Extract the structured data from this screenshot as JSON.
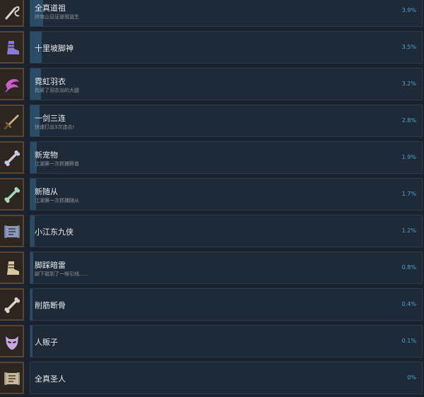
{
  "achievements": [
    {
      "title": "全真道祖",
      "description": "终南山见证道祖诞生",
      "percent": "3.9%",
      "fill_fraction": 0.039,
      "icon": "whip-icon",
      "icon_color": "#d8d2c8"
    },
    {
      "title": "十里坡脚神",
      "description": "",
      "percent": "3.5%",
      "fill_fraction": 0.035,
      "icon": "boot-icon",
      "icon_color": "#8a7ad8"
    },
    {
      "title": "霓虹羽衣",
      "description": "抱紧了羽衣派的大腿",
      "percent": "3.2%",
      "fill_fraction": 0.032,
      "icon": "feather-icon",
      "icon_color": "#c860c8"
    },
    {
      "title": "一剑三连",
      "description": "快速打出3次连击!",
      "percent": "2.8%",
      "fill_fraction": 0.028,
      "icon": "sword-icon",
      "icon_color": "#c8b078"
    },
    {
      "title": "新宠物",
      "description": "江湖第一次抓捕野兽",
      "percent": "1.9%",
      "fill_fraction": 0.019,
      "icon": "bone-icon",
      "icon_color": "#c8c8e0"
    },
    {
      "title": "新随从",
      "description": "江湖第一次抓捕随从",
      "percent": "1.7%",
      "fill_fraction": 0.017,
      "icon": "bone-icon",
      "icon_color": "#a8d8b8"
    },
    {
      "title": "小江东九侠",
      "description": "",
      "percent": "1.2%",
      "fill_fraction": 0.012,
      "icon": "scroll-icon",
      "icon_color": "#8898c0"
    },
    {
      "title": "脚踩暗雷",
      "description": "脚下碰到了一根引线......",
      "percent": "0.8%",
      "fill_fraction": 0.008,
      "icon": "boot-icon",
      "icon_color": "#d8c8a0"
    },
    {
      "title": "削筋断骨",
      "description": "",
      "percent": "0.4%",
      "fill_fraction": 0.004,
      "icon": "bone-icon",
      "icon_color": "#e0d0c0"
    },
    {
      "title": "人贩子",
      "description": "",
      "percent": "0.1%",
      "fill_fraction": 0.001,
      "icon": "mask-icon",
      "icon_color": "#c8a8e0"
    },
    {
      "title": "全真圣人",
      "description": "",
      "percent": "0%",
      "fill_fraction": 0.0,
      "icon": "scroll-icon",
      "icon_color": "#c8b898"
    }
  ]
}
